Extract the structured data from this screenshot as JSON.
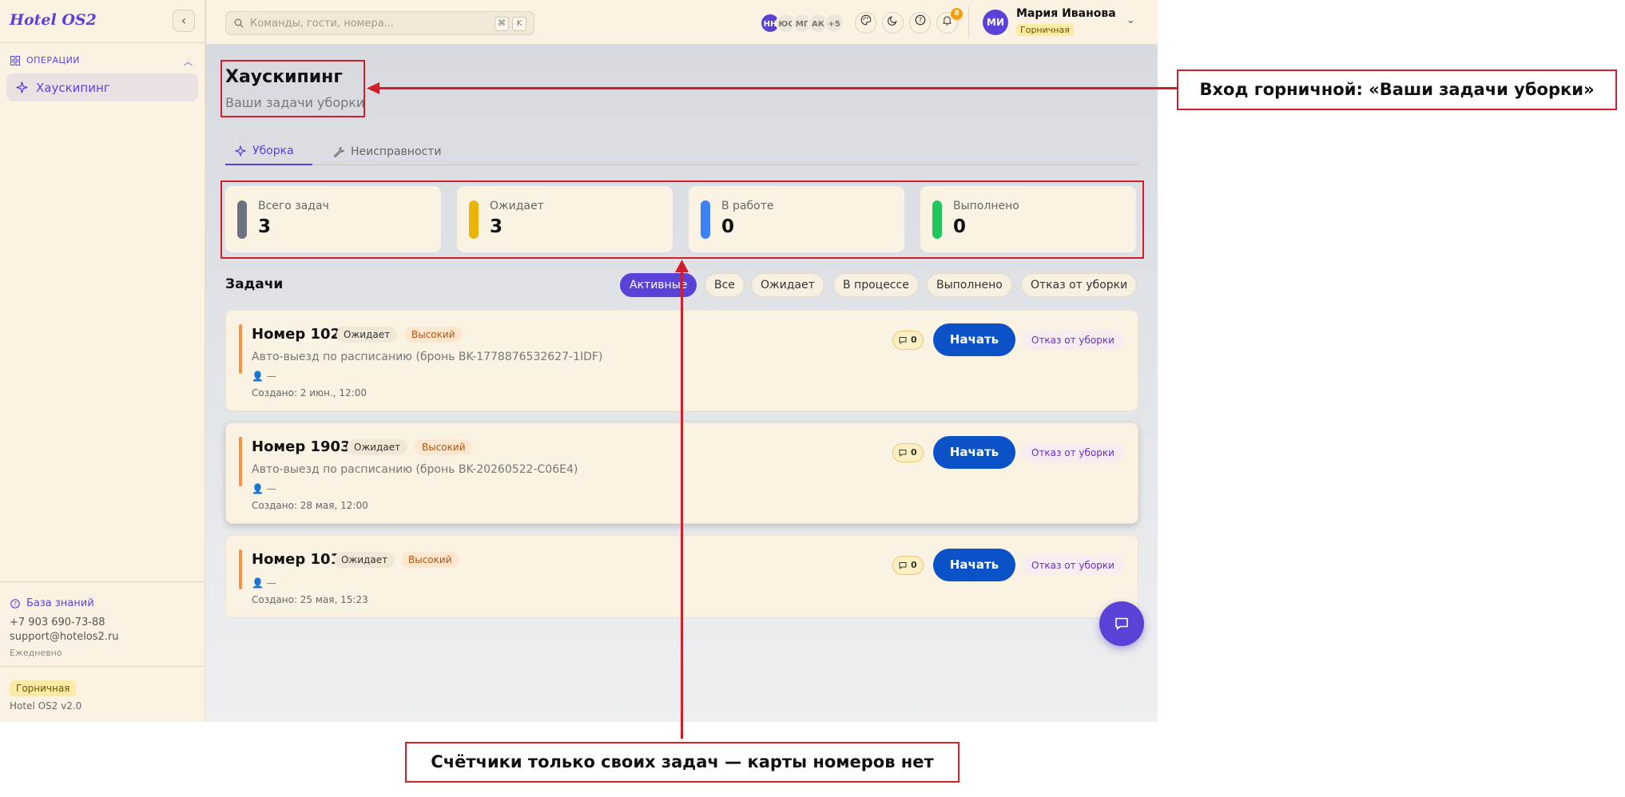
{
  "sidebar": {
    "brand": "Hotel OS2",
    "section_label": "ОПЕРАЦИИ",
    "items": [
      {
        "label": "Хаускипинг"
      }
    ],
    "knowledge_base": "База знаний",
    "phone": "+7 903 690-73-88",
    "email": "support@hotelos2.ru",
    "schedule": "Ежедневно",
    "role_badge": "Горничная",
    "version": "Hotel OS2 v2.0"
  },
  "header": {
    "search_placeholder": "Команды, гости, номера...",
    "kbd_1": "⌘",
    "kbd_2": "K",
    "presence": [
      {
        "initials": "НН",
        "bg": "#5b42d6",
        "fg": "#ffffff"
      },
      {
        "initials": "ЮС",
        "bg": "#ece6d8",
        "fg": "#777777"
      },
      {
        "initials": "МГ",
        "bg": "#ece6d8",
        "fg": "#777777"
      },
      {
        "initials": "АК",
        "bg": "#ece6d8",
        "fg": "#777777"
      },
      {
        "initials": "+5",
        "bg": "#ece6d8",
        "fg": "#777777"
      }
    ],
    "notifications_count": "8",
    "user": {
      "initials": "МИ",
      "name": "Мария Иванова",
      "role": "Горничная"
    }
  },
  "page": {
    "title": "Хаускипинг",
    "subtitle": "Ваши задачи уборки"
  },
  "tabs": [
    {
      "label": "Уборка",
      "active": true
    },
    {
      "label": "Неисправности",
      "active": false
    }
  ],
  "stats": [
    {
      "label": "Всего задач",
      "value": "3",
      "color": "#6b7280"
    },
    {
      "label": "Ожидает",
      "value": "3",
      "color": "#eab308"
    },
    {
      "label": "В работе",
      "value": "0",
      "color": "#3b82f6"
    },
    {
      "label": "Выполнено",
      "value": "0",
      "color": "#22c55e"
    }
  ],
  "tasks_heading": "Задачи",
  "filters": [
    {
      "label": "Активные",
      "active": true
    },
    {
      "label": "Все",
      "active": false
    },
    {
      "label": "Ожидает",
      "active": false
    },
    {
      "label": "В процессе",
      "active": false
    },
    {
      "label": "Выполнено",
      "active": false
    },
    {
      "label": "Отказ от уборки",
      "active": false
    }
  ],
  "tasks": [
    {
      "room": "Номер 102",
      "status": "Ожидает",
      "priority": "Высокий",
      "description": "Авто-выезд по расписанию (бронь BK-1778876532627-1IDF)",
      "assignee": "👤 —",
      "created": "Создано: 2 июн., 12:00",
      "comments": "0",
      "start_label": "Начать",
      "refuse_label": "Отказ от уборки"
    },
    {
      "room": "Номер 1903",
      "status": "Ожидает",
      "priority": "Высокий",
      "description": "Авто-выезд по расписанию (бронь BK-20260522-C06E4)",
      "assignee": "👤 —",
      "created": "Создано: 28 мая, 12:00",
      "comments": "0",
      "start_label": "Начать",
      "refuse_label": "Отказ от уборки"
    },
    {
      "room": "Номер 101",
      "status": "Ожидает",
      "priority": "Высокий",
      "description": "",
      "assignee": "👤 —",
      "created": "Создано: 25 мая, 15:23",
      "comments": "0",
      "start_label": "Начать",
      "refuse_label": "Отказ от уборки"
    }
  ],
  "annotations": {
    "top": "Вход горничной: «Ваши задачи уборки»",
    "bottom": "Счётчики только своих задач — карты номеров нет"
  },
  "colors": {
    "accent": "#5b42d6",
    "primary_button": "#0b52c9",
    "annotation": "#d01f2a",
    "priority_bar": "#f59243"
  }
}
